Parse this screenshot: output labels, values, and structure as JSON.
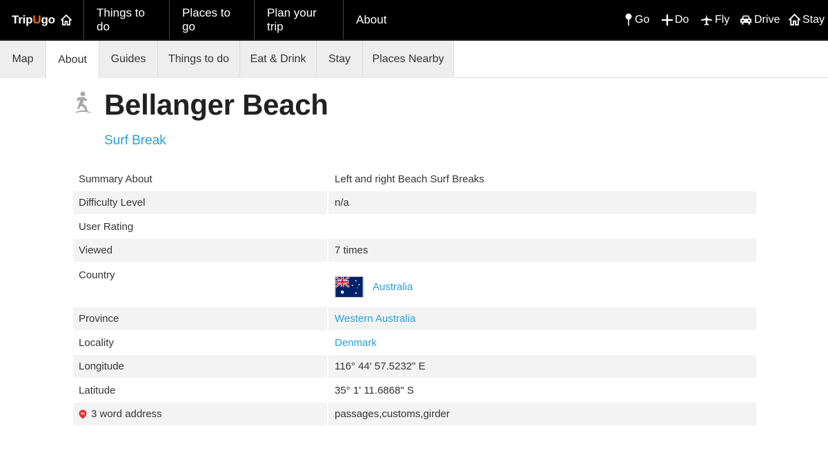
{
  "brand": {
    "name_part1": "Trip",
    "name_part2": "U",
    "name_part3": "go",
    "accent_color": "#ff6a00"
  },
  "top_nav": [
    "Things to do",
    "Places to go",
    "Plan your trip",
    "About"
  ],
  "quick_links": [
    "Go",
    "Do",
    "Fly",
    "Drive",
    "Stay"
  ],
  "tabs": [
    "Map",
    "About",
    "Guides",
    "Things to do",
    "Eat & Drink",
    "Stay",
    "Places Nearby"
  ],
  "active_tab": "About",
  "page": {
    "title": "Bellanger Beach",
    "category": "Surf Break"
  },
  "details": [
    {
      "label": "Summary About",
      "value": "Left and right Beach Surf Breaks"
    },
    {
      "label": "Difficulty Level",
      "value": "n/a"
    },
    {
      "label": "User Rating",
      "value": ""
    },
    {
      "label": "Viewed",
      "value": "7 times"
    },
    {
      "label": "Country",
      "value": "Australia"
    },
    {
      "label": "Province",
      "value": "Western Australia"
    },
    {
      "label": "Locality",
      "value": "Denmark"
    },
    {
      "label": "Longitude",
      "value": "116° 44' 57.5232\" E"
    },
    {
      "label": "Latitude",
      "value": "35° 1' 11.6868\" S"
    },
    {
      "label": "3 word address",
      "value": "passages,customs,girder"
    }
  ],
  "colors": {
    "link": "#2a9fd6",
    "topbar": "#000000",
    "row_alt": "#f3f3f3",
    "pin": "#e32b2b"
  }
}
